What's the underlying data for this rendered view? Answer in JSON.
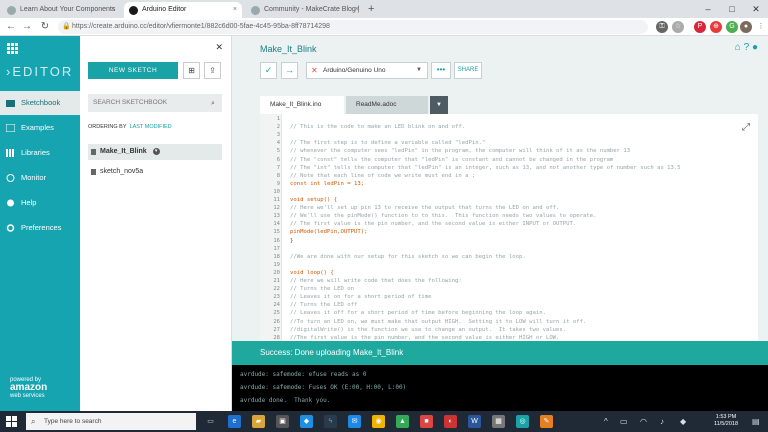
{
  "browser": {
    "tabs": [
      {
        "label": "Learn About Your Components",
        "active": false
      },
      {
        "label": "Arduino Editor",
        "active": true
      },
      {
        "label": "Community - MakeCrate Blog |",
        "active": false
      }
    ],
    "url": "https://create.arduino.cc/editor/vfiermonte1/882c6d00-5fae-4c45-95ba-8ff78714298"
  },
  "nav": {
    "logo": "EDITOR",
    "items": [
      {
        "label": "Sketchbook"
      },
      {
        "label": "Examples"
      },
      {
        "label": "Libraries"
      },
      {
        "label": "Monitor"
      },
      {
        "label": "Help"
      },
      {
        "label": "Preferences"
      }
    ],
    "powered_by": "powered by",
    "amazon": "amazon",
    "web_services": "web services"
  },
  "sketchbook": {
    "new_sketch": "NEW SKETCH",
    "search_placeholder": "SEARCH SKETCHBOOK",
    "ordering_label": "ORDERING BY",
    "ordering_value": "LAST MODIFIED",
    "items": [
      {
        "name": "Make_It_Blink",
        "active": true
      },
      {
        "name": "sketch_nov5a",
        "active": false
      }
    ]
  },
  "editor": {
    "title": "Make_It_Blink",
    "board": "Arduino/Genuino Uno",
    "more": "•••",
    "share": "SHARE",
    "file_tabs": [
      "Make_It_Blink.ino",
      "ReadMe.adoc"
    ],
    "code_lines": [
      {
        "n": "1",
        "t": "",
        "c": "plain"
      },
      {
        "n": "2",
        "t": "// This is the code to make an LED blink on and off.",
        "c": "comment"
      },
      {
        "n": "3",
        "t": "",
        "c": "plain"
      },
      {
        "n": "4",
        "t": "// The first step is to define a variable called \"ledPin.\"",
        "c": "comment"
      },
      {
        "n": "5",
        "t": "// whenever the computer sees \"ledPin\" in the program, the computer will think of it as the number 13",
        "c": "comment"
      },
      {
        "n": "6",
        "t": "// The \"const\" tells the computer that \"ledPin\" is constant and cannot be changed in the program",
        "c": "comment"
      },
      {
        "n": "7",
        "t": "// The \"int\" tells the computer that \"ledPin\" is an integer, such as 13, and not another type of number such as 13.5",
        "c": "comment"
      },
      {
        "n": "8",
        "t": "// Note that each line of code we write must end in a ;",
        "c": "comment"
      },
      {
        "n": "9",
        "t": "const int ledPin = 13;",
        "c": "kw"
      },
      {
        "n": "10",
        "t": "",
        "c": "plain"
      },
      {
        "n": "11",
        "t": "void setup() {",
        "c": "kw"
      },
      {
        "n": "12",
        "t": "// Here we'll set up pin 13 to receive the output that turns the LED on and off.",
        "c": "comment"
      },
      {
        "n": "13",
        "t": "// We'll use the pinMode() function to to this.  This function needs two values to operate.",
        "c": "comment"
      },
      {
        "n": "14",
        "t": "// The first value is the pin number, and the second value is either INPUT or OUTPUT.",
        "c": "comment"
      },
      {
        "n": "15",
        "t": "pinMode(ledPin,OUTPUT);",
        "c": "kw"
      },
      {
        "n": "16",
        "t": "}",
        "c": "plain"
      },
      {
        "n": "17",
        "t": "",
        "c": "plain"
      },
      {
        "n": "18",
        "t": "//We are done with our setup for this sketch so we can begin the loop.",
        "c": "comment"
      },
      {
        "n": "19",
        "t": "",
        "c": "plain"
      },
      {
        "n": "20",
        "t": "void loop() {",
        "c": "kw"
      },
      {
        "n": "21",
        "t": "// Here we will write code that does the following:",
        "c": "comment"
      },
      {
        "n": "22",
        "t": "// Turns the LED on",
        "c": "comment"
      },
      {
        "n": "23",
        "t": "// Leaves it on for a short period of time",
        "c": "comment"
      },
      {
        "n": "24",
        "t": "// Turns the LED off",
        "c": "comment"
      },
      {
        "n": "25",
        "t": "// Leaves it off for a short period of time before beginning the loop again.",
        "c": "comment"
      },
      {
        "n": "26",
        "t": "//To turn an LED on, we must make that output HIGH.  Setting it to LOW will turn it off.",
        "c": "comment"
      },
      {
        "n": "27",
        "t": "//digitalWrite() is the function we use to change an output.  It takes two values.",
        "c": "comment"
      },
      {
        "n": "28",
        "t": "//The first value is the pin number, and the second value is either HIGH or LOW.",
        "c": "comment"
      }
    ],
    "status": "Success: Done uploading Make_It_Blink",
    "console": [
      "avrdude: safemode: efuse reads as 0",
      "avrdude: safemode: Fuses OK (E:00, H:00, L:00)",
      "avrdude done.  Thank you."
    ]
  },
  "taskbar": {
    "search_placeholder": "Type here to search",
    "time": "1:53 PM",
    "date": "11/5/2018"
  }
}
